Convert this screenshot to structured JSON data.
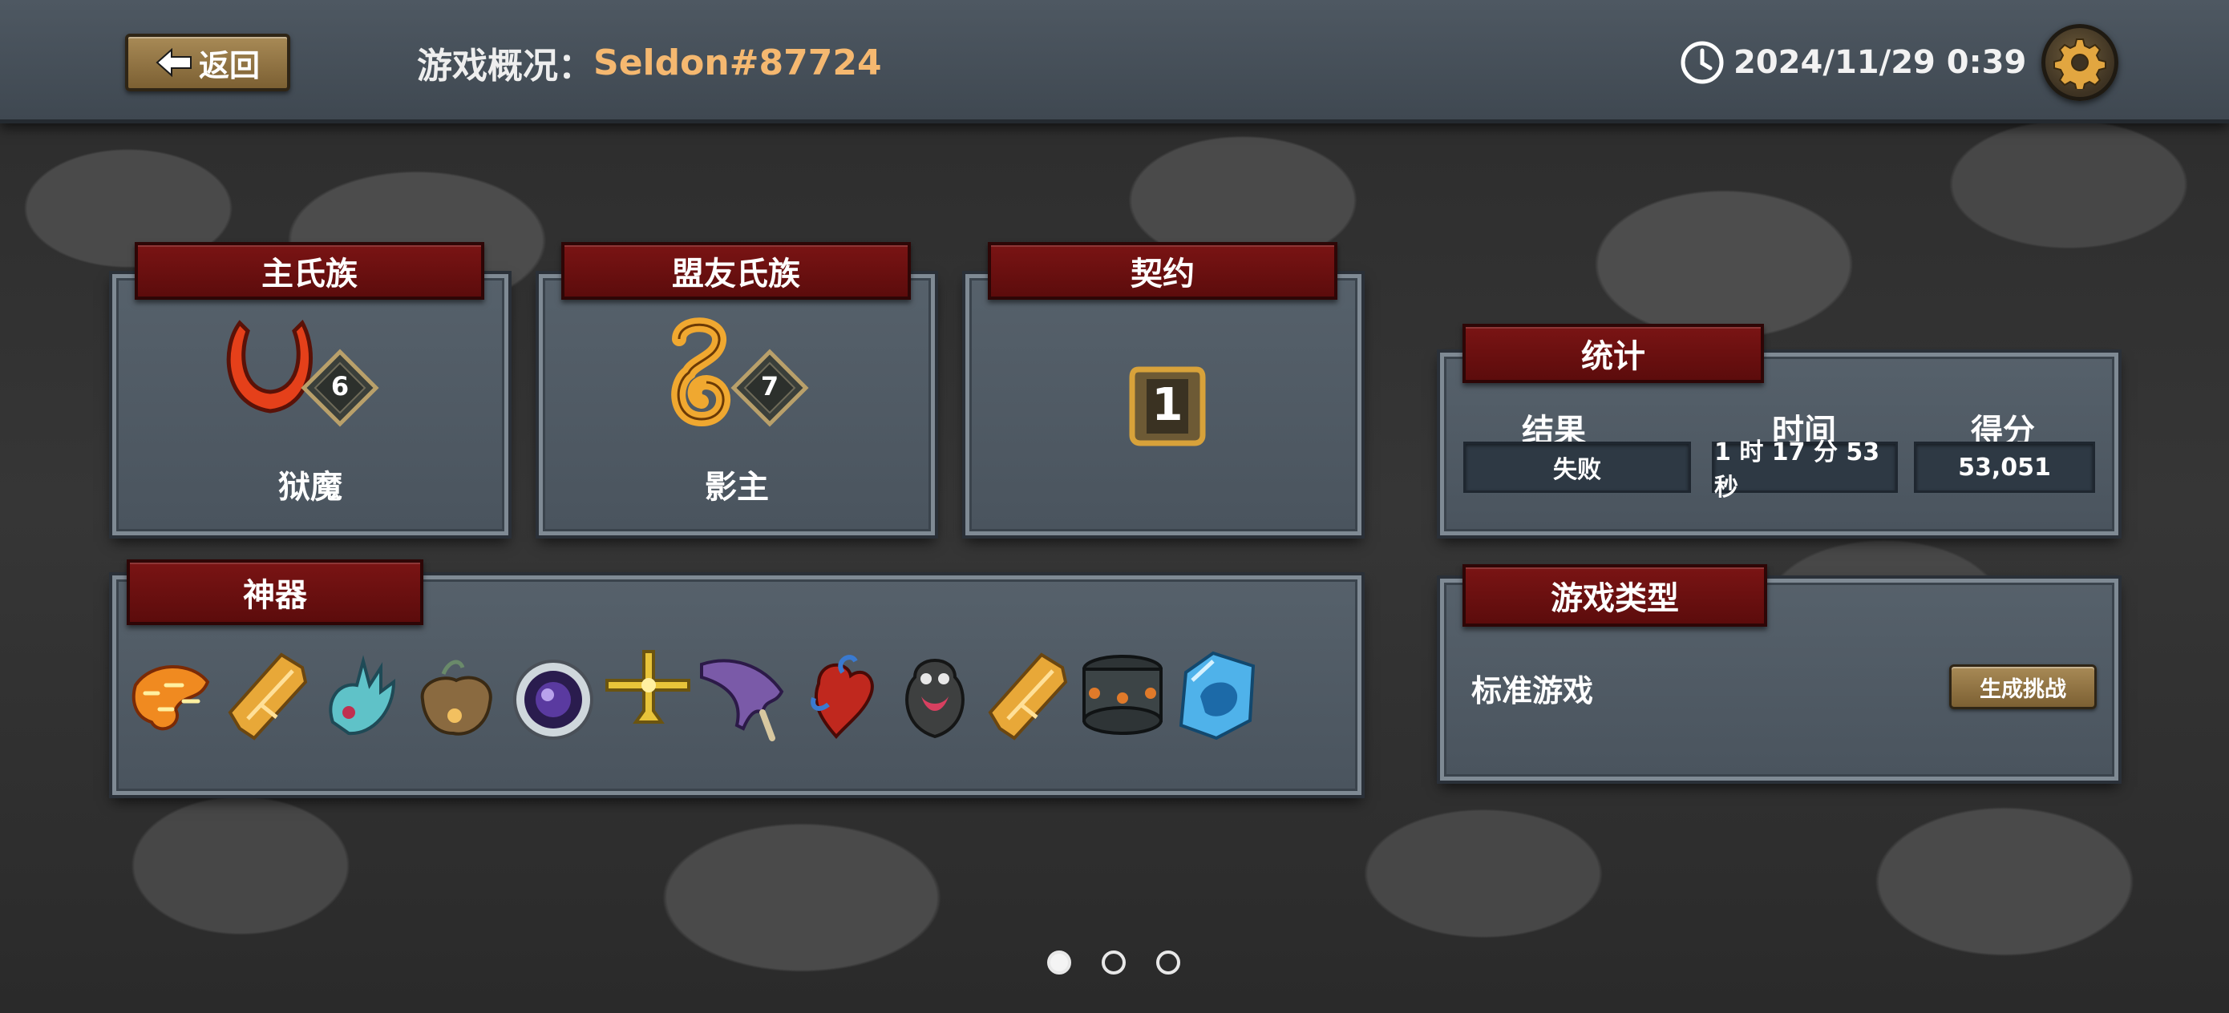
{
  "header": {
    "back_label": "返回",
    "title_prefix": "游戏概况：",
    "player_name": "Seldon#87724",
    "datetime": "2024/11/29 0:39",
    "icons": [
      "back-arrow-icon",
      "clock-icon",
      "gear-icon"
    ]
  },
  "main_clan": {
    "title": "主氏族",
    "name": "狱魔",
    "level": "6",
    "emblem": "horn-emblem-icon",
    "color": "#e8441c"
  },
  "ally_clan": {
    "title": "盟友氏族",
    "name": "影主",
    "level": "7",
    "emblem": "spiral-emblem-icon",
    "color": "#f0a830"
  },
  "covenant": {
    "title": "契约",
    "level": "1",
    "icon": "covenant-badge-icon"
  },
  "stats": {
    "title": "统计",
    "result_label": "结果",
    "result_value": "失败",
    "time_label": "时间",
    "time_value": "1 时 17 分 53 秒",
    "score_label": "得分",
    "score_value": "53,051"
  },
  "game_type": {
    "title": "游戏类型",
    "mode": "标准游戏",
    "challenge_button": "生成挑战"
  },
  "artifacts": {
    "title": "神器",
    "items": [
      "chain-claw-icon",
      "gold-gem-icon",
      "blue-claw-icon",
      "pouch-icon",
      "void-orb-icon",
      "golden-cross-icon",
      "bone-blade-icon",
      "red-heart-icon",
      "ghost-urn-icon",
      "gold-gem-icon",
      "iron-band-icon",
      "ice-crystal-icon"
    ]
  },
  "pager": {
    "pages": 3,
    "active": 0
  },
  "colors": {
    "accent_gold": "#f5b870",
    "ribbon_red": "#6e1010",
    "panel_bg": "#525d67"
  }
}
